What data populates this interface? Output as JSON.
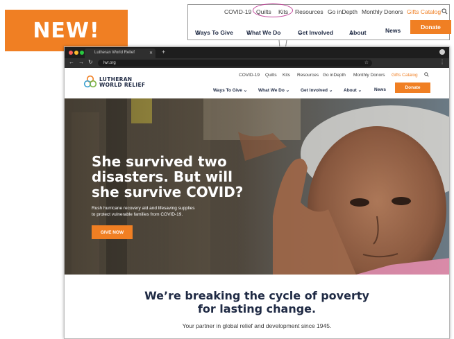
{
  "badge": {
    "label": "NEW!"
  },
  "callout": {
    "utility": [
      "COVID-19",
      "Quilts",
      "Kits",
      "Resources",
      "Go inDepth",
      "Monthly Donors",
      "Gifts Catalog"
    ],
    "nav": [
      "Ways To Give",
      "What We Do",
      "Get Involved",
      "About",
      "News"
    ],
    "donate": "Donate"
  },
  "browser": {
    "tab_title": "Lutheran World Relief",
    "url": "lwr.org"
  },
  "site": {
    "logo_line1": "LUTHERAN",
    "logo_line2": "WORLD RELIEF",
    "utility": [
      "COVID-19",
      "Quilts",
      "Kits",
      "Resources",
      "Go inDepth",
      "Monthly Donors",
      "Gifts Catalog"
    ],
    "nav": [
      "Ways To Give",
      "What We Do",
      "Get Involved",
      "About",
      "News"
    ],
    "donate": "Donate"
  },
  "hero": {
    "headline": [
      "She survived two",
      "disasters. But will",
      "she survive COVID?"
    ],
    "subtext": [
      "Rush hurricane recovery aid and lifesaving supplies",
      "to protect vulnerable families from COVID-19."
    ],
    "cta": "GIVE NOW"
  },
  "tagline": [
    "We’re breaking the cycle of poverty",
    "for lasting change."
  ],
  "partner": "Your partner in global relief and development since 1945.",
  "colors": {
    "accent": "#f07f23",
    "navy": "#1f2a44",
    "highlight": "#c2479b"
  },
  "icons": {
    "search": "search-icon",
    "chevron": "chevron-down-icon",
    "star": "star-icon"
  }
}
